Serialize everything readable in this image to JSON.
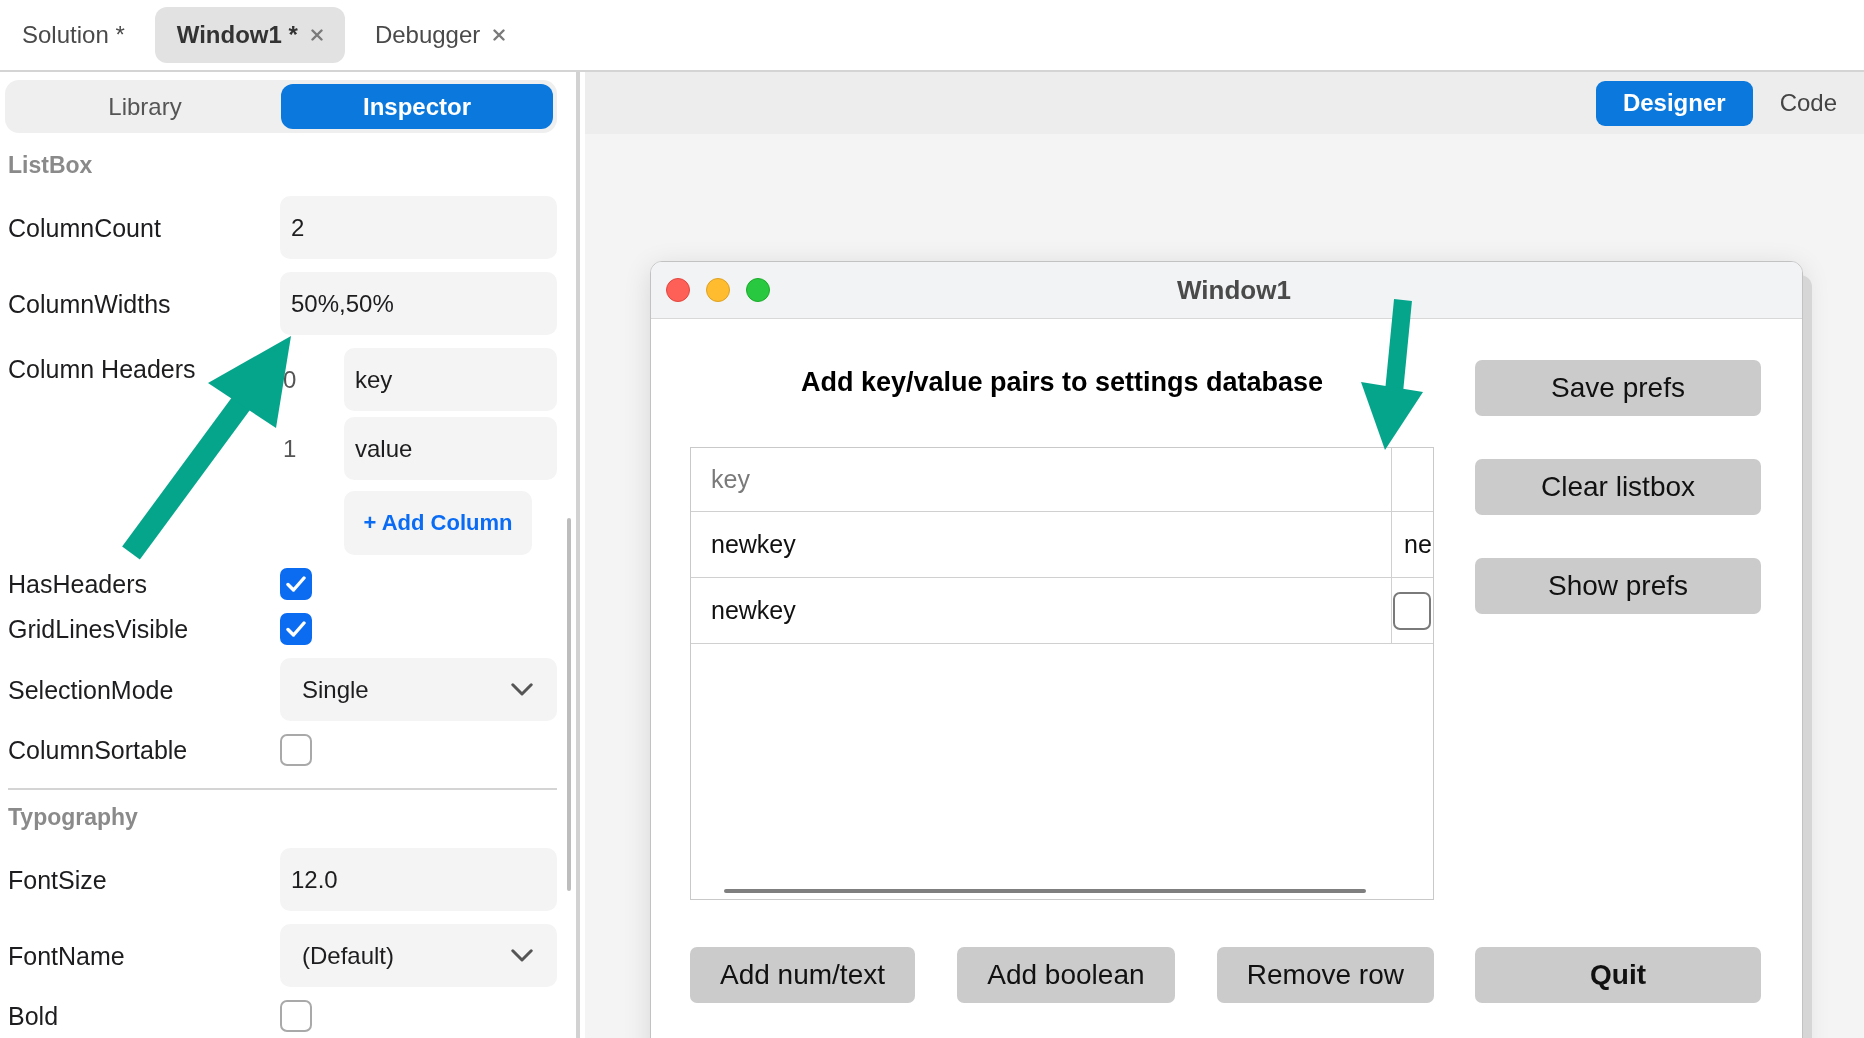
{
  "document_tabs": [
    {
      "label": "Solution *",
      "selected": false,
      "closable": false
    },
    {
      "label": "Window1 *",
      "selected": true,
      "closable": true
    },
    {
      "label": "Debugger",
      "selected": false,
      "closable": true
    }
  ],
  "side_panel": {
    "tabs": [
      {
        "label": "Library",
        "selected": false
      },
      {
        "label": "Inspector",
        "selected": true
      }
    ],
    "sections": [
      {
        "title": "ListBox",
        "properties": [
          {
            "kind": "text",
            "label": "ColumnCount",
            "value": "2"
          },
          {
            "kind": "text",
            "label": "ColumnWidths",
            "value": "50%,50%"
          },
          {
            "kind": "list",
            "label": "Column Headers",
            "items": [
              {
                "index": "0",
                "value": "key"
              },
              {
                "index": "1",
                "value": "value"
              }
            ],
            "add_button": "+ Add Column"
          },
          {
            "kind": "checkbox",
            "label": "HasHeaders",
            "checked": true
          },
          {
            "kind": "checkbox",
            "label": "GridLinesVisible",
            "checked": true
          },
          {
            "kind": "dropdown",
            "label": "SelectionMode",
            "value": "Single"
          },
          {
            "kind": "checkbox",
            "label": "ColumnSortable",
            "checked": false
          }
        ]
      },
      {
        "title": "Typography",
        "properties": [
          {
            "kind": "text",
            "label": "FontSize",
            "value": "12.0"
          },
          {
            "kind": "dropdown",
            "label": "FontName",
            "value": "(Default)"
          },
          {
            "kind": "checkbox",
            "label": "Bold",
            "checked": false
          }
        ]
      }
    ]
  },
  "view_tabs": [
    {
      "label": "Designer",
      "selected": true
    },
    {
      "label": "Code",
      "selected": false
    }
  ],
  "form_window": {
    "title": "Window1",
    "heading": "Add key/value pairs to settings database",
    "listbox": {
      "columns": [
        {
          "label": "key"
        }
      ],
      "rows": [
        {
          "cells": [
            {
              "kind": "text",
              "text": "newkey"
            },
            {
              "kind": "text",
              "text": "ne"
            }
          ]
        },
        {
          "cells": [
            {
              "kind": "text",
              "text": "newkey"
            },
            {
              "kind": "checkbox",
              "checked": false
            }
          ]
        }
      ]
    },
    "side_buttons": [
      {
        "label": "Save prefs",
        "bold": false
      },
      {
        "label": "Clear listbox",
        "bold": false
      },
      {
        "label": "Show prefs",
        "bold": false
      }
    ],
    "bottom_buttons": [
      {
        "label": "Add num/text",
        "bold": false
      },
      {
        "label": "Add boolean",
        "bold": false
      },
      {
        "label": "Remove row",
        "bold": false
      }
    ],
    "quit_button": {
      "label": "Quit",
      "bold": true
    }
  }
}
